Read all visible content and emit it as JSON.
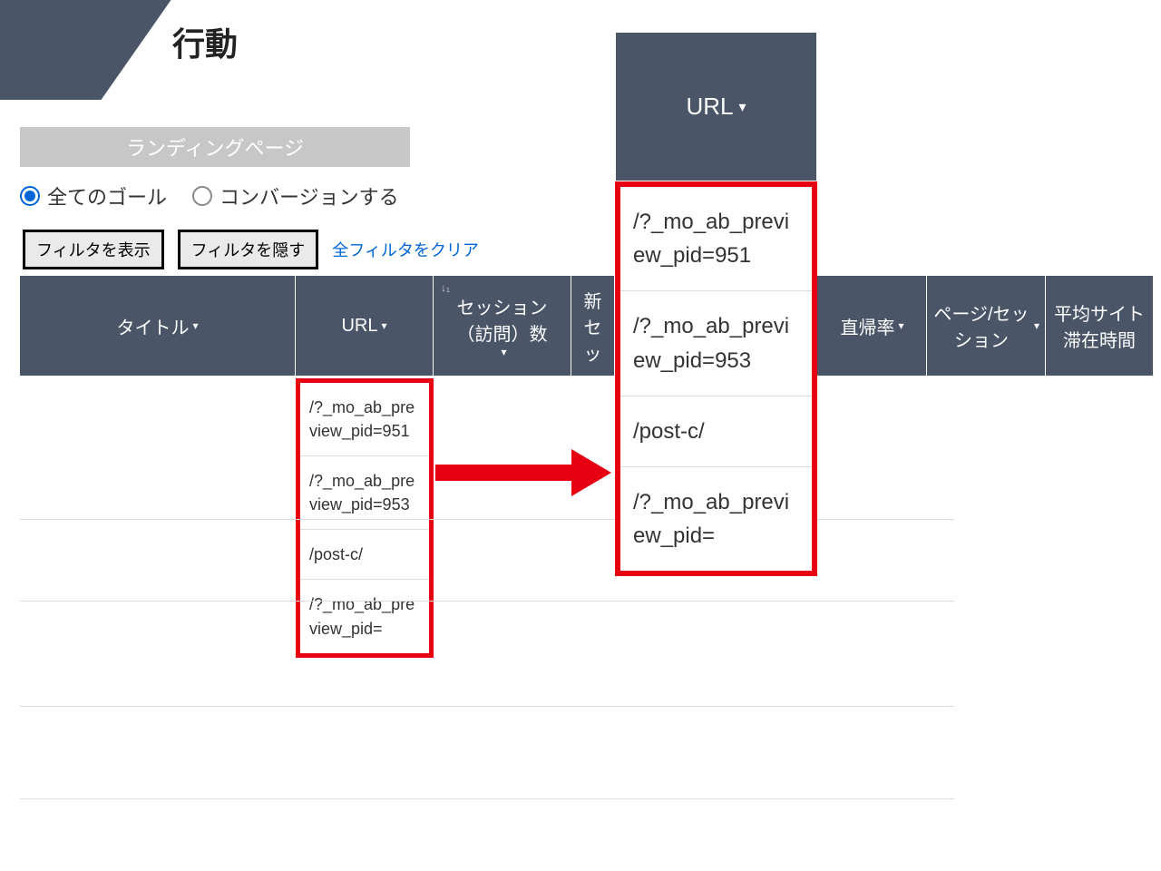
{
  "page": {
    "title": "行動"
  },
  "lp_button": "ランディングページ",
  "radios": {
    "all_goals": "全てのゴール",
    "conversion": "コンバージョンする"
  },
  "filters": {
    "show": "フィルタを表示",
    "hide": "フィルタを隠す",
    "clear_all": "全フィルタをクリア"
  },
  "columns": {
    "title": "タイトル",
    "url": "URL",
    "sessions": "セッション（訪問）数",
    "new_session": "新セッ",
    "bounce": "直帰率",
    "pages_per_session": "ページ/セッション",
    "avg_time": "平均サイト滞在時間"
  },
  "zoom_header": "URL",
  "url_rows_small": [
    "/?_mo_ab_preview_pid=951",
    "/?_mo_ab_preview_pid=953",
    "/post-c/",
    "/?_mo_ab_preview_pid="
  ],
  "url_rows_large": [
    "/?_mo_ab_preview_pid=951",
    "/?_mo_ab_preview_pid=953",
    "/post-c/",
    "/?_mo_ab_preview_pid="
  ]
}
